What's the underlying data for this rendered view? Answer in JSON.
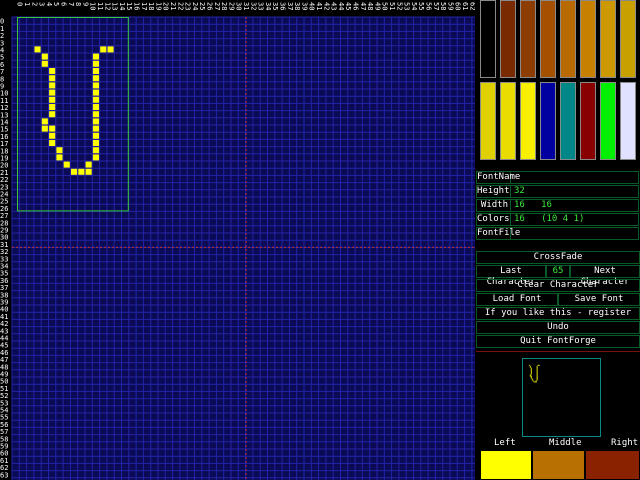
{
  "grid": {
    "cols": 64,
    "rows": 64,
    "col_labels": [
      "0",
      "1",
      "2",
      "3",
      "4",
      "5",
      "6",
      "7",
      "8",
      "9",
      "10",
      "11",
      "12",
      "13",
      "14",
      "15",
      "16",
      "17",
      "18",
      "19",
      "20",
      "21",
      "22",
      "23",
      "24",
      "25",
      "26",
      "27",
      "28",
      "29",
      "30",
      "31",
      "32",
      "33",
      "34",
      "35",
      "36",
      "37",
      "38",
      "39",
      "40",
      "41",
      "42",
      "43",
      "44",
      "45",
      "46",
      "47",
      "48",
      "49",
      "50",
      "51",
      "52",
      "53",
      "54",
      "55",
      "56",
      "57",
      "58",
      "59",
      "60",
      "61",
      "62",
      "63"
    ],
    "row_labels": [
      "0",
      "1",
      "2",
      "3",
      "4",
      "5",
      "6",
      "7",
      "8",
      "9",
      "10",
      "11",
      "12",
      "13",
      "14",
      "15",
      "16",
      "17",
      "18",
      "19",
      "20",
      "21",
      "22",
      "23",
      "24",
      "25",
      "26",
      "27",
      "28",
      "29",
      "30",
      "31",
      "32",
      "33",
      "34",
      "35",
      "36",
      "37",
      "38",
      "39",
      "40",
      "41",
      "42",
      "43",
      "44",
      "45",
      "46",
      "47",
      "48",
      "49",
      "50",
      "51",
      "52",
      "53",
      "54",
      "55",
      "56",
      "57",
      "58",
      "59",
      "60",
      "61",
      "62",
      "63"
    ],
    "glyph_cols": 16,
    "glyph_rows": 32,
    "pixel_color": "#ffff00",
    "glyph_pixels": [
      [
        3,
        4
      ],
      [
        4,
        5
      ],
      [
        4,
        6
      ],
      [
        5,
        7
      ],
      [
        5,
        8
      ],
      [
        5,
        9
      ],
      [
        5,
        10
      ],
      [
        5,
        11
      ],
      [
        5,
        12
      ],
      [
        5,
        13
      ],
      [
        4,
        14
      ],
      [
        4,
        15
      ],
      [
        5,
        15
      ],
      [
        5,
        16
      ],
      [
        5,
        17
      ],
      [
        6,
        18
      ],
      [
        6,
        19
      ],
      [
        7,
        20
      ],
      [
        8,
        21
      ],
      [
        9,
        21
      ],
      [
        10,
        21
      ],
      [
        10,
        20
      ],
      [
        11,
        19
      ],
      [
        11,
        18
      ],
      [
        11,
        17
      ],
      [
        11,
        16
      ],
      [
        11,
        15
      ],
      [
        11,
        14
      ],
      [
        11,
        13
      ],
      [
        11,
        12
      ],
      [
        11,
        11
      ],
      [
        11,
        10
      ],
      [
        11,
        9
      ],
      [
        11,
        8
      ],
      [
        11,
        7
      ],
      [
        11,
        6
      ],
      [
        11,
        5
      ],
      [
        12,
        4
      ],
      [
        13,
        4
      ]
    ]
  },
  "palette": {
    "colors": [
      "#000000",
      "#7a2a00",
      "#8e3d00",
      "#a45000",
      "#b86a00",
      "#c88000",
      "#cc9a00",
      "#c8a000",
      "#e0d000",
      "#e8dc00",
      "#f8f000",
      "#0000a0",
      "#008888",
      "#880000",
      "#00f000",
      "#e0e0ff"
    ]
  },
  "info": {
    "font_name_label": "FontName",
    "font_name_value": "",
    "height_label": "Height",
    "height_value": "32",
    "width_label": "Width",
    "width_value": "16   16",
    "colors_label": "Colors",
    "colors_value": "16   (10 4 1)",
    "fontfile_label": "FontFile",
    "fontfile_value": ""
  },
  "menu": {
    "crossfade": "CrossFade",
    "last_character": "Last Character",
    "char_code": "65",
    "next_character": "Next Character",
    "clear_character": "Clear Character",
    "load_font": "Load Font",
    "save_font": "Save Font",
    "register": "If you like this - register",
    "undo": "Undo",
    "quit": "Quit FontForge"
  },
  "mouse_buttons": {
    "left_label": "Left",
    "middle_label": "Middle",
    "right_label": "Right",
    "left_color": "#ffff00",
    "middle_color": "#b87000",
    "right_color": "#8a2200"
  }
}
